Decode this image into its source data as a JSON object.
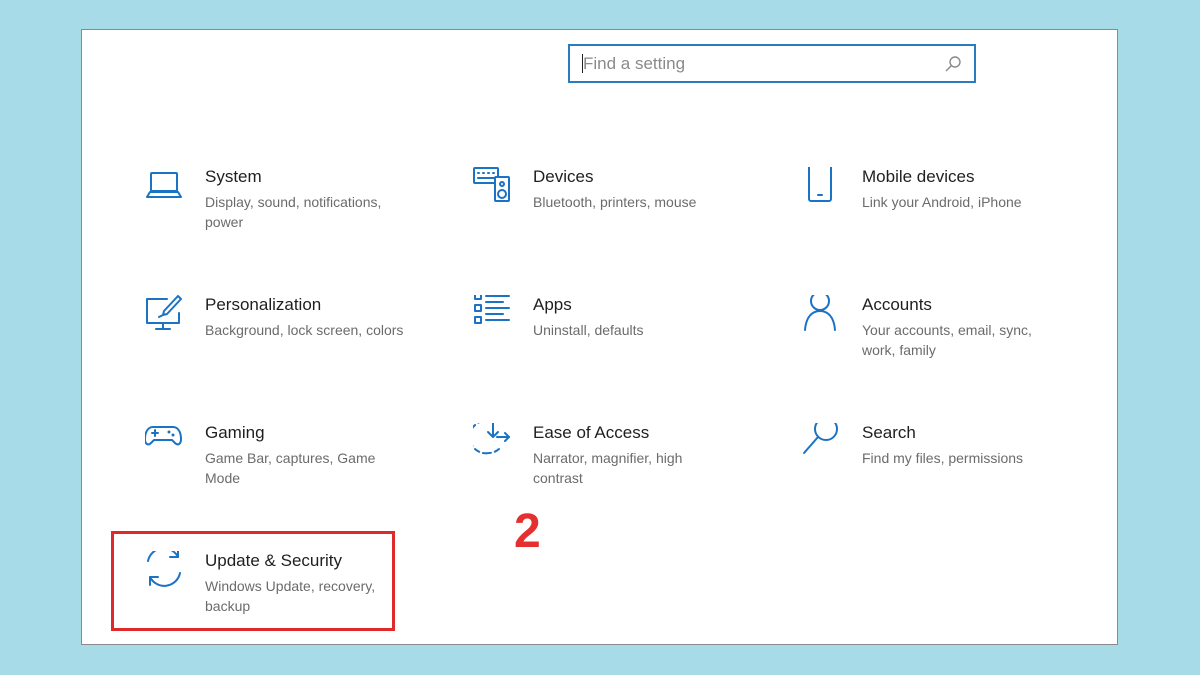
{
  "search": {
    "placeholder": "Find a setting",
    "value": ""
  },
  "tiles": [
    {
      "id": "system",
      "icon": "laptop-icon",
      "title": "System",
      "desc": "Display, sound, notifications, power"
    },
    {
      "id": "devices",
      "icon": "keyboard-speaker-icon",
      "title": "Devices",
      "desc": "Bluetooth, printers, mouse"
    },
    {
      "id": "mobile",
      "icon": "phone-icon",
      "title": "Mobile devices",
      "desc": "Link your Android, iPhone"
    },
    {
      "id": "personalization",
      "icon": "paintbrush-monitor-icon",
      "title": "Personalization",
      "desc": "Background, lock screen, colors"
    },
    {
      "id": "apps",
      "icon": "apps-list-icon",
      "title": "Apps",
      "desc": "Uninstall, defaults"
    },
    {
      "id": "accounts",
      "icon": "person-icon",
      "title": "Accounts",
      "desc": "Your accounts, email, sync, work, family"
    },
    {
      "id": "gaming",
      "icon": "gamepad-icon",
      "title": "Gaming",
      "desc": "Game Bar, captures, Game Mode"
    },
    {
      "id": "ease",
      "icon": "ease-of-access-icon",
      "title": "Ease of Access",
      "desc": "Narrator, magnifier, high contrast"
    },
    {
      "id": "search",
      "icon": "magnifier-icon",
      "title": "Search",
      "desc": "Find my files, permissions"
    },
    {
      "id": "update",
      "icon": "sync-arrows-icon",
      "title": "Update & Security",
      "desc": "Windows Update, recovery, backup"
    }
  ],
  "annotation": {
    "step": "2",
    "color": "#e02a2a"
  },
  "colors": {
    "accent": "#1a73c4",
    "background": "#a8dbe8"
  }
}
